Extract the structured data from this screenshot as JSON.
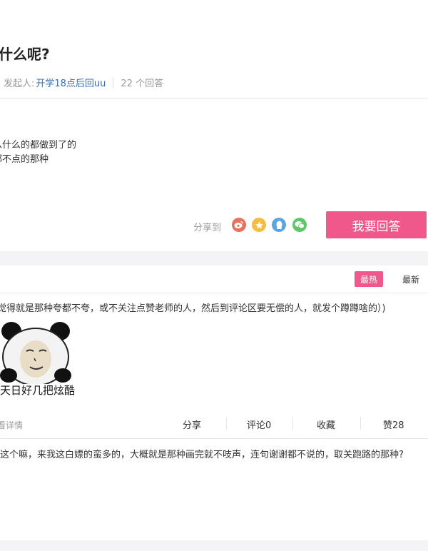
{
  "question": {
    "title": "是什么呢?",
    "initiator_label": "发起人:",
    "initiator_name": "开学18点后回uu",
    "answer_count": "22 个回答",
    "body_lines": [
      "么什么的都做到了的",
      "都不点的那种"
    ]
  },
  "share": {
    "label": "分享到",
    "icons": [
      "weibo-icon",
      "qzone-star-icon",
      "qq-icon",
      "wechat-icon"
    ],
    "answer_button": "我要回答"
  },
  "sort": {
    "hot": "最热",
    "new": "最新"
  },
  "answers": [
    {
      "text": "觉得就是那种夸都不夸，或不关注点赞老师的人，然后到评论区要无偿的人，就发个蹲蹲啥的）)",
      "image_caption": "天日好几把炫酷",
      "view_detail": "看详情",
      "actions": {
        "share": "分享",
        "comment": "评论0",
        "favorite": "收藏",
        "like": "赞28"
      }
    },
    {
      "text": "这个嘛，来我这白嫖的蛮多的，大概就是那种画完就不吱声，连句谢谢都不说的，取关跑路的那种?"
    }
  ],
  "colors": {
    "accent_pink": "#f0578a",
    "link_blue": "#3a6bb3",
    "muted_gray": "#999999"
  }
}
